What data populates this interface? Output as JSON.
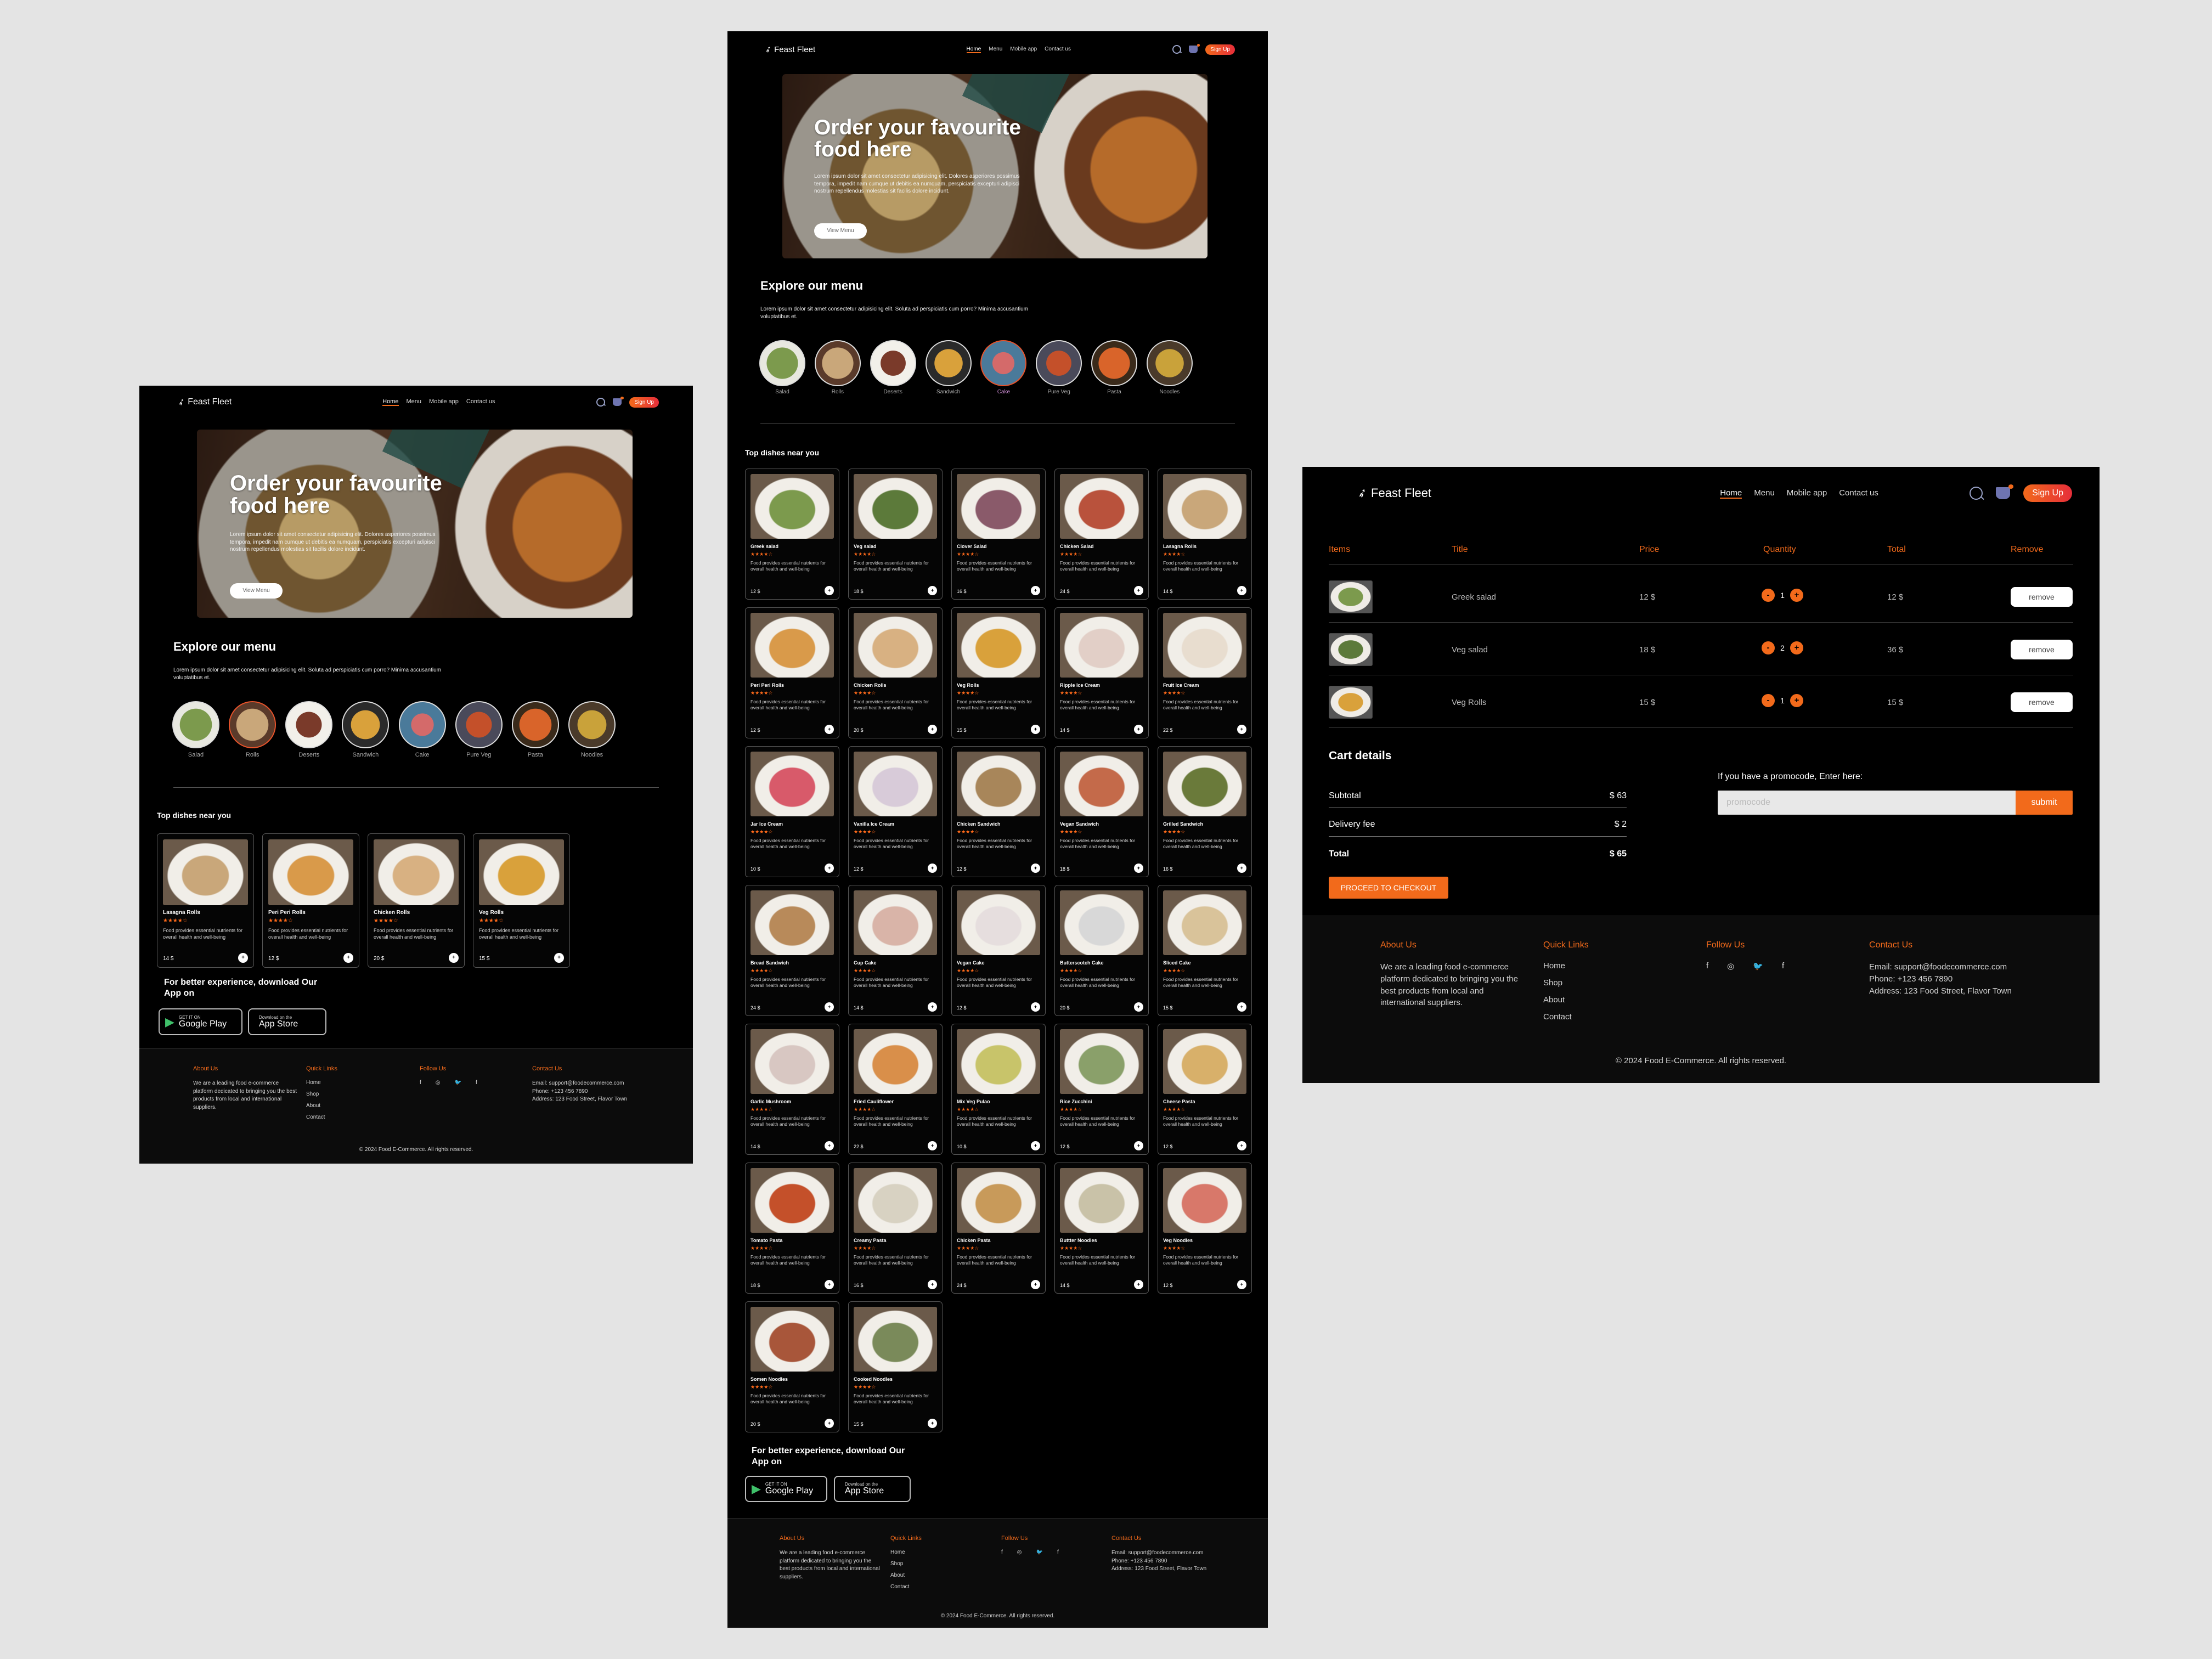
{
  "brand": {
    "name": "Feast Fleet",
    "logo_icon": "leaf-icon"
  },
  "nav": {
    "links": [
      "Home",
      "Menu",
      "Mobile app",
      "Contact us"
    ],
    "active": "Home",
    "signup_label": "Sign Up",
    "search_icon": "search-icon",
    "cart_icon": "basket-icon"
  },
  "hero": {
    "title": "Order your favourite food here",
    "text": "Lorem ipsum dolor sit amet consectetur adipisicing elit. Dolores asperiores possimus tempora, impedit nam cumque ut debitis ea numquam, perspiciatis excepturi adipisci nostrum repellendus molestias sit facilis dolore incidunt.",
    "button_label": "View Menu"
  },
  "explore": {
    "title": "Explore our menu",
    "text": "Lorem ipsum dolor sit amet consectetur adipisicing elit. Soluta ad perspiciatis cum porro? Minima accusantium voluptatibus et.",
    "categories": [
      "Salad",
      "Rolls",
      "Deserts",
      "Sandwich",
      "Cake",
      "Pure Veg",
      "Pasta",
      "Noodles"
    ]
  },
  "top_dishes": {
    "title": "Top dishes near you",
    "description": "Food provides essential nutrients for overall health and well-being",
    "stars": "★★★★☆",
    "add_symbol": "+",
    "dishes_home": [
      {
        "name": "Lasagna Rolls",
        "price": "14 $",
        "color": "#c9a77a"
      },
      {
        "name": "Peri Peri Rolls",
        "price": "12 $",
        "color": "#d99a4a"
      },
      {
        "name": "Chicken Rolls",
        "price": "20 $",
        "color": "#d8b182"
      },
      {
        "name": "Veg Rolls",
        "price": "15 $",
        "color": "#d9a13b"
      }
    ],
    "dishes_all": [
      {
        "name": "Greek salad",
        "price": "12 $",
        "color": "#7c9a4d"
      },
      {
        "name": "Veg salad",
        "price": "18 $",
        "color": "#5c7a3a"
      },
      {
        "name": "Clover Salad",
        "price": "16 $",
        "color": "#8a5a6a"
      },
      {
        "name": "Chicken Salad",
        "price": "24 $",
        "color": "#b9523c"
      },
      {
        "name": "Lasagna Rolls",
        "price": "14 $",
        "color": "#c9a77a"
      },
      {
        "name": "Peri Peri Rolls",
        "price": "12 $",
        "color": "#d99a4a"
      },
      {
        "name": "Chicken Rolls",
        "price": "20 $",
        "color": "#d8b182"
      },
      {
        "name": "Veg Rolls",
        "price": "15 $",
        "color": "#d9a13b"
      },
      {
        "name": "Ripple Ice Cream",
        "price": "14 $",
        "color": "#e2cfc7"
      },
      {
        "name": "Fruit Ice Cream",
        "price": "22 $",
        "color": "#e8ddcf"
      },
      {
        "name": "Jar Ice Cream",
        "price": "10 $",
        "color": "#d85a6a"
      },
      {
        "name": "Vanilla Ice Cream",
        "price": "12 $",
        "color": "#d8cbd9"
      },
      {
        "name": "Chicken Sandwich",
        "price": "12 $",
        "color": "#a8865a"
      },
      {
        "name": "Vegan Sandwich",
        "price": "18 $",
        "color": "#c46a4a"
      },
      {
        "name": "Grilled Sandwich",
        "price": "16 $",
        "color": "#6a7a3a"
      },
      {
        "name": "Bread Sandwich",
        "price": "24 $",
        "color": "#b88a5a"
      },
      {
        "name": "Cup Cake",
        "price": "14 $",
        "color": "#d9b4a8"
      },
      {
        "name": "Vegan Cake",
        "price": "12 $",
        "color": "#e6dede"
      },
      {
        "name": "Butterscotch Cake",
        "price": "20 $",
        "color": "#d8d8d8"
      },
      {
        "name": "Sliced Cake",
        "price": "15 $",
        "color": "#d9c39a"
      },
      {
        "name": "Garlic Mushroom",
        "price": "14 $",
        "color": "#d8c7c2"
      },
      {
        "name": "Fried Cauliflower",
        "price": "22 $",
        "color": "#d98f4a"
      },
      {
        "name": "Mix Veg Pulao",
        "price": "10 $",
        "color": "#c8c46a"
      },
      {
        "name": "Rice Zucchini",
        "price": "12 $",
        "color": "#8aa06a"
      },
      {
        "name": "Cheese Pasta",
        "price": "12 $",
        "color": "#d8b06a"
      },
      {
        "name": "Tomato Pasta",
        "price": "18 $",
        "color": "#c4502a"
      },
      {
        "name": "Creamy Pasta",
        "price": "16 $",
        "color": "#d8d2c2"
      },
      {
        "name": "Chicken Pasta",
        "price": "24 $",
        "color": "#c89a5a"
      },
      {
        "name": "Buttter Noodles",
        "price": "14 $",
        "color": "#c9c2a8"
      },
      {
        "name": "Veg Noodles",
        "price": "12 $",
        "color": "#d8786a"
      },
      {
        "name": "Somen Noodles",
        "price": "20 $",
        "color": "#a8563a"
      },
      {
        "name": "Cooked Noodles",
        "price": "15 $",
        "color": "#7a8a5a"
      }
    ]
  },
  "app_download": {
    "title": "For better experience, download Our App on",
    "google_small": "GET IT ON",
    "google_label": "Google Play",
    "apple_small": "Download on the",
    "apple_label": "App Store"
  },
  "footer": {
    "about_title": "About Us",
    "about_text": "We are a leading food e-commerce platform dedicated to bringing you the best products from local and international suppliers.",
    "links_title": "Quick Links",
    "links": [
      "Home",
      "Shop",
      "About",
      "Contact"
    ],
    "follow_title": "Follow Us",
    "socials": [
      "f",
      "◎",
      "🐦",
      "f"
    ],
    "contact_title": "Contact Us",
    "email": "Email: support@foodecommerce.com",
    "phone": "Phone: +123 456 7890",
    "address": "Address: 123 Food Street, Flavor Town",
    "copyright": "© 2024 Food E-Commerce. All rights reserved."
  },
  "cart": {
    "headers": [
      "Items",
      "Title",
      "Price",
      "Quantity",
      "Total",
      "Remove"
    ],
    "rows": [
      {
        "title": "Greek salad",
        "price": "12 $",
        "qty": "1",
        "total": "12 $",
        "color": "#7c9a4d"
      },
      {
        "title": "Veg salad",
        "price": "18 $",
        "qty": "2",
        "total": "36 $",
        "color": "#5c7a3a"
      },
      {
        "title": "Veg Rolls",
        "price": "15 $",
        "qty": "1",
        "total": "15 $",
        "color": "#d9a13b"
      }
    ],
    "minus": "-",
    "plus": "+",
    "remove_label": "remove",
    "details_title": "Cart details",
    "subtotal_label": "Subtotal",
    "subtotal": "$ 63",
    "delivery_label": "Delivery fee",
    "delivery": "$ 2",
    "total_label": "Total",
    "total": "$ 65",
    "checkout_label": "PROCEED TO CHECKOUT",
    "promo_label": "If you have a promocode, Enter here:",
    "promo_placeholder": "promocode",
    "submit_label": "submit"
  },
  "colors": {
    "accent": "#f26a1b",
    "background": "#000000",
    "page": "#e4e4e4"
  }
}
